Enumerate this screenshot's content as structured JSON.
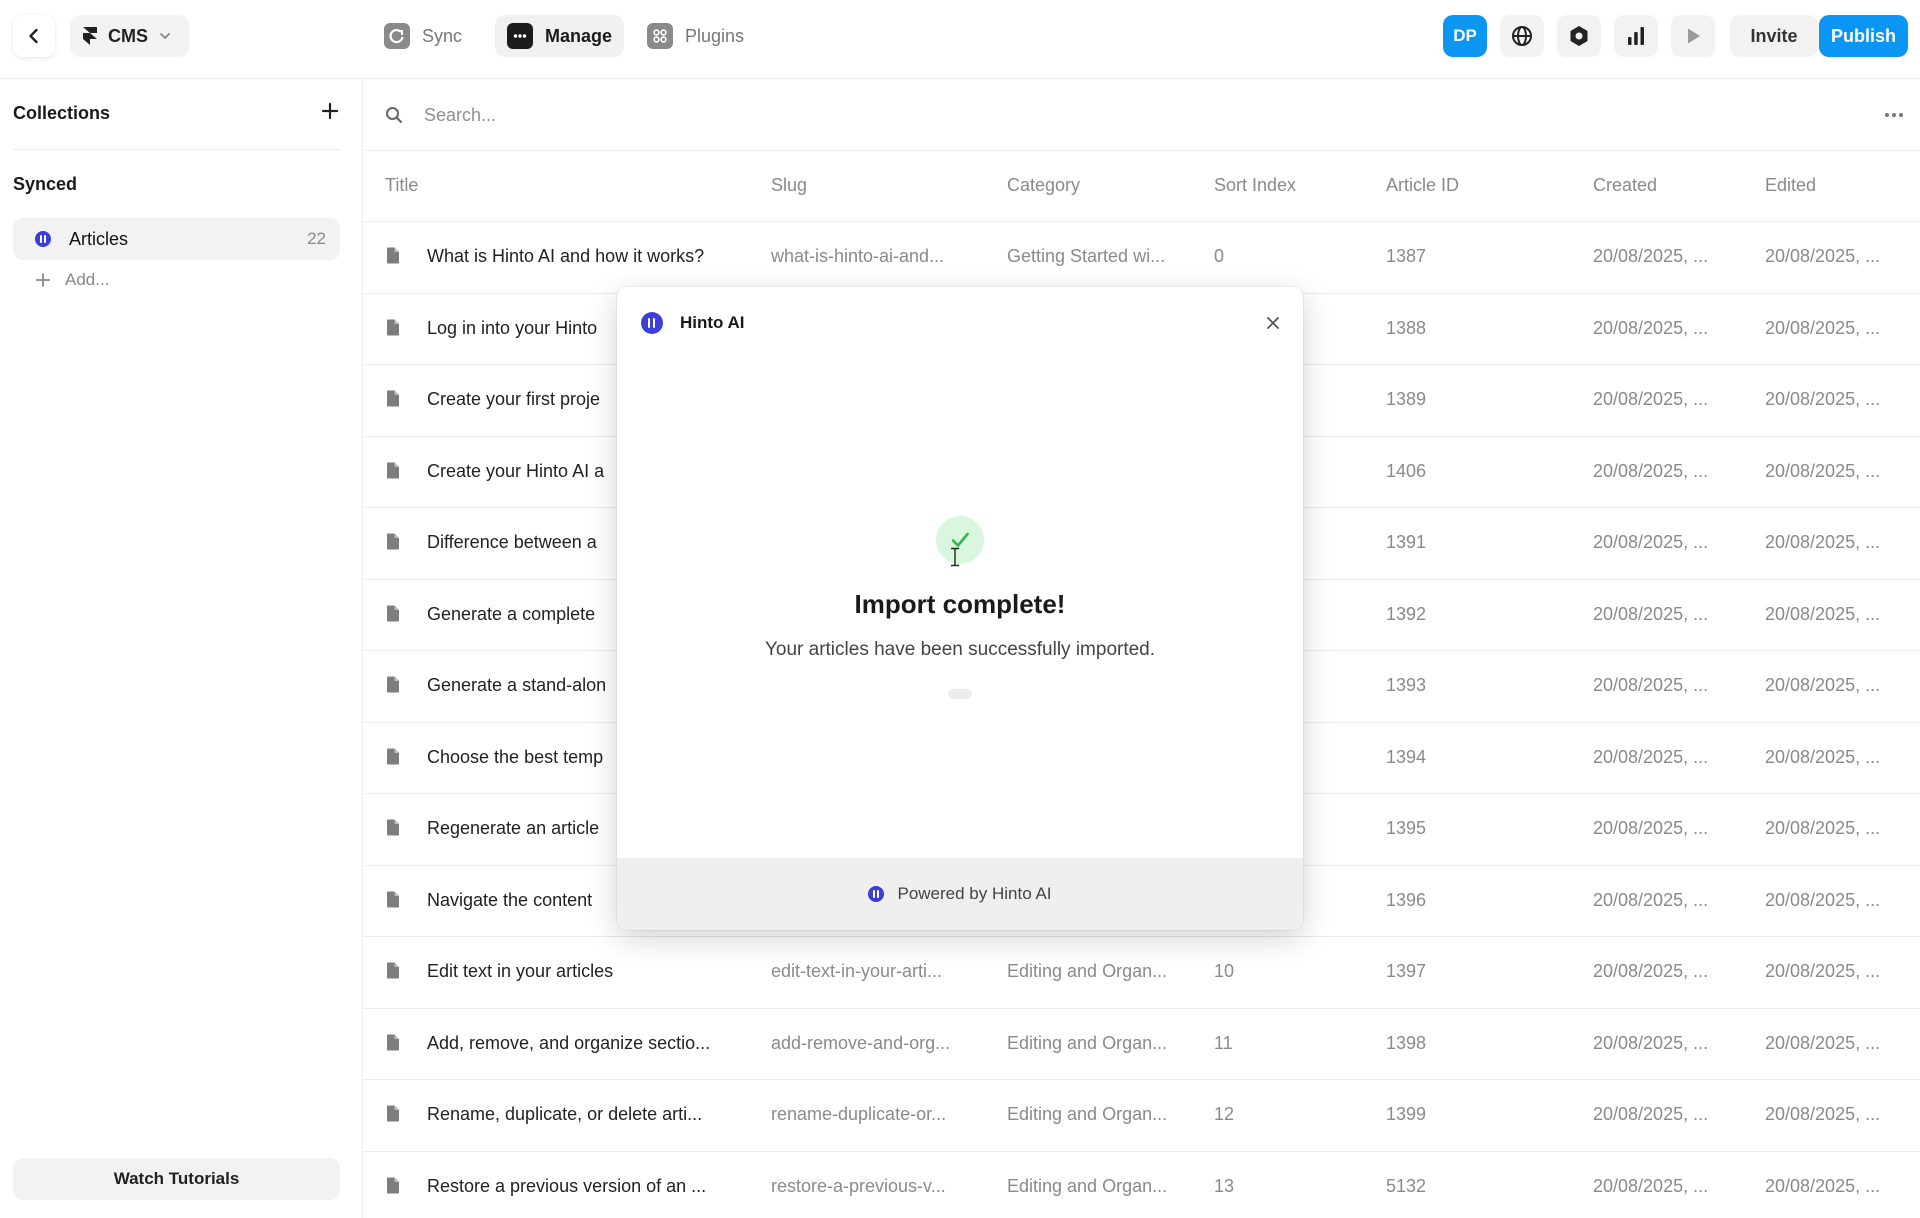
{
  "topbar": {
    "back_icon": "chevron-left-icon",
    "app_switch_label": "CMS",
    "tabs": [
      {
        "label": "Sync",
        "icon": "sync-icon",
        "active": false
      },
      {
        "label": "Manage",
        "icon": "manage-icon",
        "active": true
      },
      {
        "label": "Plugins",
        "icon": "plugins-icon",
        "active": false
      }
    ],
    "avatar": "DP",
    "invite_label": "Invite",
    "publish_label": "Publish",
    "accent_color": "#0a96f2"
  },
  "sidebar": {
    "collections_heading": "Collections",
    "synced_heading": "Synced",
    "items": [
      {
        "label": "Articles",
        "count": "22"
      }
    ],
    "add_label": "Add...",
    "watch_tutorials_label": "Watch Tutorials"
  },
  "search": {
    "placeholder": "Search..."
  },
  "table": {
    "columns": [
      "Title",
      "Slug",
      "Category",
      "Sort Index",
      "Article ID",
      "Created",
      "Edited"
    ],
    "rows": [
      {
        "title": "What is Hinto AI and how it works?",
        "slug": "what-is-hinto-ai-and...",
        "category": "Getting Started wi...",
        "sort": "0",
        "id": "1387",
        "created": "20/08/2025, ...",
        "edited": "20/08/2025, ..."
      },
      {
        "title": "Log in into your Hinto",
        "slug": "",
        "category": "",
        "sort": "",
        "id": "1388",
        "created": "20/08/2025, ...",
        "edited": "20/08/2025, ..."
      },
      {
        "title": "Create your first proje",
        "slug": "",
        "category": "",
        "sort": "",
        "id": "1389",
        "created": "20/08/2025, ...",
        "edited": "20/08/2025, ..."
      },
      {
        "title": "Create your Hinto AI a",
        "slug": "",
        "category": "",
        "sort": "",
        "id": "1406",
        "created": "20/08/2025, ...",
        "edited": "20/08/2025, ..."
      },
      {
        "title": "Difference between a",
        "slug": "",
        "category": "",
        "sort": "",
        "id": "1391",
        "created": "20/08/2025, ...",
        "edited": "20/08/2025, ..."
      },
      {
        "title": "Generate a complete",
        "slug": "",
        "category": "",
        "sort": "",
        "id": "1392",
        "created": "20/08/2025, ...",
        "edited": "20/08/2025, ..."
      },
      {
        "title": "Generate a stand-alon",
        "slug": "",
        "category": "",
        "sort": "",
        "id": "1393",
        "created": "20/08/2025, ...",
        "edited": "20/08/2025, ..."
      },
      {
        "title": "Choose the best temp",
        "slug": "",
        "category": "",
        "sort": "",
        "id": "1394",
        "created": "20/08/2025, ...",
        "edited": "20/08/2025, ..."
      },
      {
        "title": "Regenerate an article",
        "slug": "",
        "category": "",
        "sort": "",
        "id": "1395",
        "created": "20/08/2025, ...",
        "edited": "20/08/2025, ..."
      },
      {
        "title": "Navigate the content",
        "slug": "",
        "category": "",
        "sort": "",
        "id": "1396",
        "created": "20/08/2025, ...",
        "edited": "20/08/2025, ..."
      },
      {
        "title": "Edit text in your articles",
        "slug": "edit-text-in-your-arti...",
        "category": "Editing and Organ...",
        "sort": "10",
        "id": "1397",
        "created": "20/08/2025, ...",
        "edited": "20/08/2025, ..."
      },
      {
        "title": "Add, remove, and organize sectio...",
        "slug": "add-remove-and-org...",
        "category": "Editing and Organ...",
        "sort": "11",
        "id": "1398",
        "created": "20/08/2025, ...",
        "edited": "20/08/2025, ..."
      },
      {
        "title": "Rename, duplicate, or delete arti...",
        "slug": "rename-duplicate-or...",
        "category": "Editing and Organ...",
        "sort": "12",
        "id": "1399",
        "created": "20/08/2025, ...",
        "edited": "20/08/2025, ..."
      },
      {
        "title": "Restore a previous version of an ...",
        "slug": "restore-a-previous-v...",
        "category": "Editing and Organ...",
        "sort": "13",
        "id": "5132",
        "created": "20/08/2025, ...",
        "edited": "20/08/2025, ..."
      }
    ]
  },
  "modal": {
    "title": "Hinto AI",
    "heading": "Import complete!",
    "message": "Your articles have been successfully imported.",
    "footer": "Powered by Hinto AI",
    "success_color": "#2fb84a",
    "brand_color": "#3b3fd8"
  }
}
